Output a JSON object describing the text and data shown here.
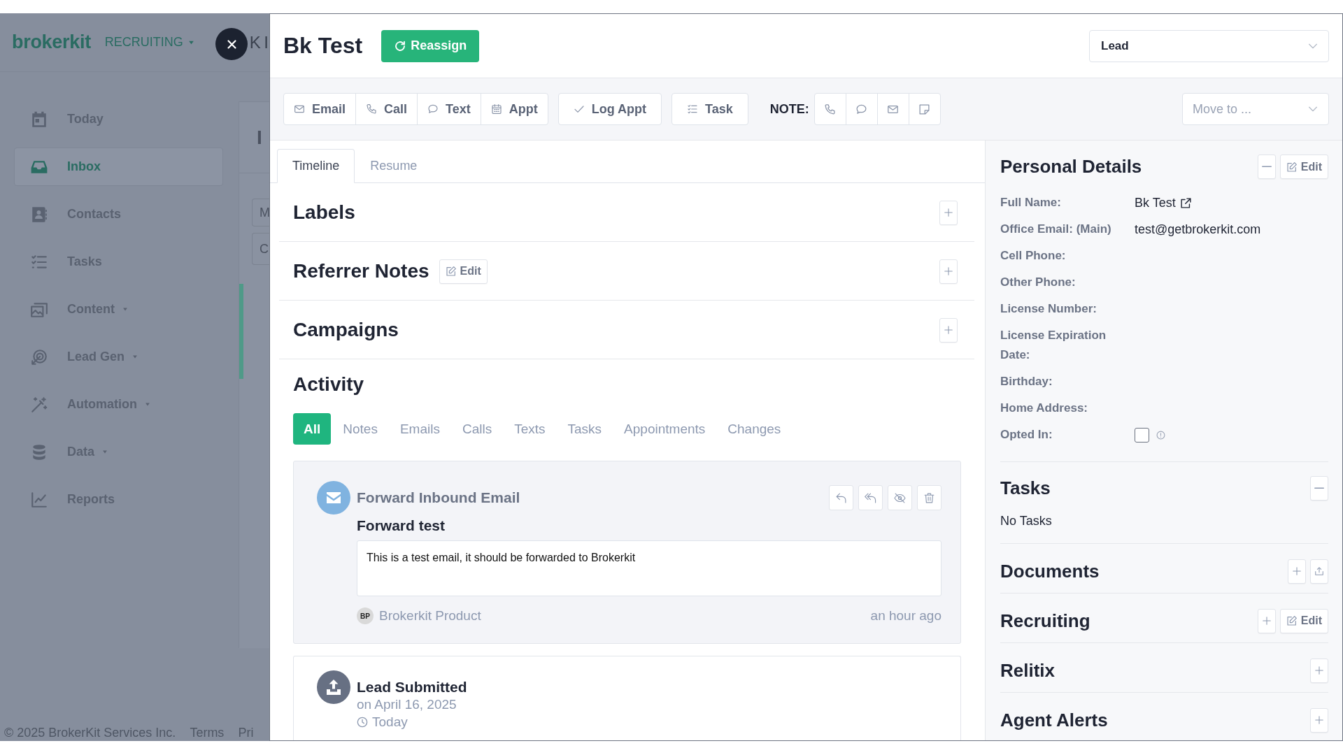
{
  "background_app": {
    "logo": "brokerkit",
    "workspace": "RECRUITING",
    "header_text": "K I",
    "sidebar": [
      {
        "label": "Today",
        "selected": false,
        "has_menu": false
      },
      {
        "label": "Inbox",
        "selected": true,
        "has_menu": false
      },
      {
        "label": "Contacts",
        "selected": false,
        "has_menu": false
      },
      {
        "label": "Tasks",
        "selected": false,
        "has_menu": false
      },
      {
        "label": "Content",
        "selected": false,
        "has_menu": true
      },
      {
        "label": "Lead Gen",
        "selected": false,
        "has_menu": true
      },
      {
        "label": "Automation",
        "selected": false,
        "has_menu": true
      },
      {
        "label": "Data",
        "selected": false,
        "has_menu": true
      },
      {
        "label": "Reports",
        "selected": false,
        "has_menu": false
      }
    ],
    "panel": {
      "title": "I",
      "fields": [
        "M",
        "C"
      ]
    },
    "footer": {
      "copyright": "© 2025 BrokerKit Services Inc.",
      "links": [
        "Terms",
        "Pri"
      ]
    }
  },
  "contact": {
    "name": "Bk Test",
    "reassign": "Reassign",
    "stage": "Lead"
  },
  "toolbar": {
    "groups": [
      {
        "buttons": [
          {
            "kind": "email",
            "label": "Email"
          },
          {
            "kind": "call",
            "label": "Call"
          },
          {
            "kind": "text",
            "label": "Text"
          },
          {
            "kind": "appt",
            "label": "Appt"
          }
        ]
      },
      {
        "buttons": [
          {
            "kind": "log",
            "label": "Log Appt"
          }
        ]
      },
      {
        "buttons": [
          {
            "kind": "task",
            "label": "Task"
          }
        ]
      }
    ],
    "note_label": "NOTE:",
    "note_buttons": [
      {
        "kind": "call"
      },
      {
        "kind": "text"
      },
      {
        "kind": "email"
      },
      {
        "kind": "note"
      }
    ],
    "move_to": {
      "placeholder": "Move to ..."
    }
  },
  "tabs": [
    {
      "label": "Timeline",
      "selected": true
    },
    {
      "label": "Resume",
      "selected": false
    }
  ],
  "sections": [
    {
      "title": "Labels",
      "buttons": [
        {
          "kind": "add"
        }
      ]
    },
    {
      "title": "Referrer Notes",
      "inline_button": {
        "kind": "edit",
        "label": "Edit"
      },
      "buttons": [
        {
          "kind": "add"
        }
      ]
    },
    {
      "title": "Campaigns",
      "buttons": [
        {
          "kind": "add"
        }
      ]
    }
  ],
  "activity": {
    "title": "Activity",
    "filters": [
      {
        "label": "All",
        "selected": true
      },
      {
        "label": "Notes",
        "selected": false
      },
      {
        "label": "Emails",
        "selected": false
      },
      {
        "label": "Calls",
        "selected": false
      },
      {
        "label": "Texts",
        "selected": false
      },
      {
        "label": "Tasks",
        "selected": false
      },
      {
        "label": "Appointments",
        "selected": false
      },
      {
        "label": "Changes",
        "selected": false
      }
    ],
    "items": [
      {
        "kind": "email",
        "heading": "Forward Inbound Email",
        "subject": "Forward test",
        "body": "This is a test email, it should be forwarded to Brokerkit",
        "author_initials": "BP",
        "author": "Brokerkit Product",
        "time": "an hour ago",
        "actions": [
          {
            "kind": "reply"
          },
          {
            "kind": "reply_all"
          },
          {
            "kind": "hide"
          },
          {
            "kind": "delete"
          }
        ]
      },
      {
        "kind": "lead",
        "heading": "Lead Submitted",
        "date": "on April 16, 2025",
        "time": "Today"
      }
    ]
  },
  "personal_details": {
    "title": "Personal Details",
    "buttons": [
      {
        "kind": "collapse"
      },
      {
        "kind": "edit",
        "label": "Edit"
      }
    ],
    "fields": [
      {
        "label": "Full Name:",
        "value": "Bk Test",
        "kind": "link"
      },
      {
        "label": "Office Email: (Main)",
        "value": "test@getbrokerkit.com",
        "kind": "text"
      },
      {
        "label": "Cell Phone:",
        "kind": "text"
      },
      {
        "label": "Other Phone:",
        "kind": "text"
      },
      {
        "label": "License Number:",
        "kind": "text"
      },
      {
        "label": "License Expiration Date:",
        "kind": "text"
      },
      {
        "label": "Birthday:",
        "kind": "text"
      },
      {
        "label": "Home Address:",
        "kind": "text"
      },
      {
        "label": "Opted In:",
        "kind": "checkbox",
        "checked": false
      }
    ]
  },
  "side_sections": [
    {
      "title": "Tasks",
      "buttons": [
        {
          "kind": "collapse"
        }
      ],
      "empty_text": "No Tasks"
    },
    {
      "title": "Documents",
      "buttons": [
        {
          "kind": "add"
        },
        {
          "kind": "upload"
        }
      ]
    },
    {
      "title": "Recruiting",
      "buttons": [
        {
          "kind": "add"
        },
        {
          "kind": "edit",
          "label": "Edit"
        }
      ]
    },
    {
      "title": "Relitix",
      "buttons": [
        {
          "kind": "add"
        }
      ]
    },
    {
      "title": "Agent Alerts",
      "buttons": [
        {
          "kind": "add"
        }
      ]
    }
  ]
}
